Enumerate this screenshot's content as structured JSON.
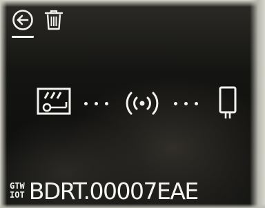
{
  "header": {
    "back_icon": "back-arrow-circle-icon",
    "delete_icon": "trash-icon"
  },
  "topology": {
    "nodes": [
      "gateway-icon",
      "wireless-signal-icon",
      "sensor-device-icon"
    ],
    "connector": "dotted-line"
  },
  "device": {
    "badge_line1": "GTW",
    "badge_line2": "IOT",
    "id": "BDRT.00007EAE"
  },
  "colors": {
    "foreground": "#f2f2ee",
    "background": "#121211"
  }
}
